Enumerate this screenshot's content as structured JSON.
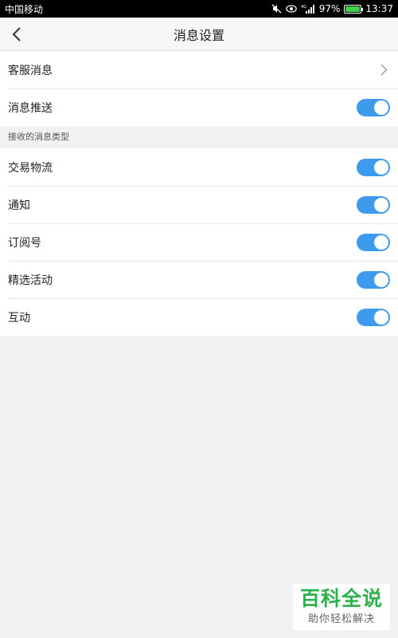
{
  "statusbar": {
    "carrier": "中国移动",
    "battery_percent": "97%",
    "battery_level": 0.97,
    "time": "13:37",
    "network_label": "4G"
  },
  "navbar": {
    "title": "消息设置"
  },
  "service": {
    "label": "客服消息"
  },
  "push": {
    "label": "消息推送",
    "on": true
  },
  "section": {
    "header": "接收的消息类型"
  },
  "types": [
    {
      "label": "交易物流",
      "on": true
    },
    {
      "label": "通知",
      "on": true
    },
    {
      "label": "订阅号",
      "on": true
    },
    {
      "label": "精选活动",
      "on": true
    },
    {
      "label": "互动",
      "on": true
    }
  ],
  "watermark": {
    "title": "百科全说",
    "subtitle": "助你轻松解决"
  },
  "colors": {
    "toggle_on": "#3d9bef",
    "watermark_green": "#2bb24c"
  }
}
